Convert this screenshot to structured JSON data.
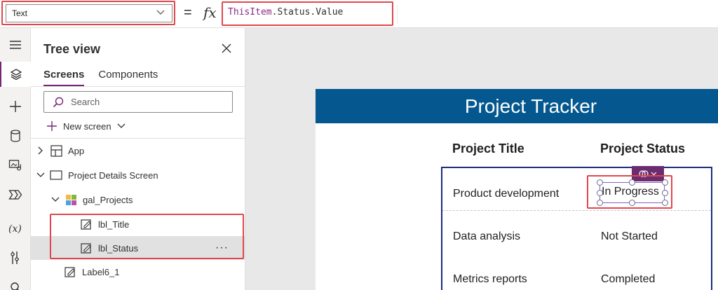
{
  "formula_bar": {
    "property": "Text",
    "equals": "=",
    "fx": "fx",
    "formula_item": "ThisItem",
    "formula_rest": ".Status.Value"
  },
  "rail": {
    "icons": [
      "hamburger-icon",
      "layers-icon",
      "insert-plus-icon",
      "data-cylinder-icon",
      "media-icon",
      "power-automate-icon",
      "variables-icon",
      "advanced-tools-icon",
      "search-icon"
    ]
  },
  "tree": {
    "title": "Tree view",
    "tabs": [
      "Screens",
      "Components"
    ],
    "search_placeholder": "Search",
    "new_screen": "New screen",
    "nodes": {
      "app": "App",
      "screen": "Project Details Screen",
      "gallery": "gal_Projects",
      "lbl_title": "lbl_Title",
      "lbl_status": "lbl_Status",
      "label6": "Label6_1",
      "more": "···"
    }
  },
  "app_preview": {
    "title": "Project Tracker",
    "col_title": "Project Title",
    "col_status": "Project Status",
    "rows": [
      {
        "title": "Product development",
        "status": "In Progress"
      },
      {
        "title": "Data analysis",
        "status": "Not Started"
      },
      {
        "title": "Metrics reports",
        "status": "Completed"
      }
    ]
  },
  "colors": {
    "header": "#04588f",
    "accent": "#742774",
    "highlight": "#e0474c",
    "gallery_border": "#1f2b7c"
  }
}
